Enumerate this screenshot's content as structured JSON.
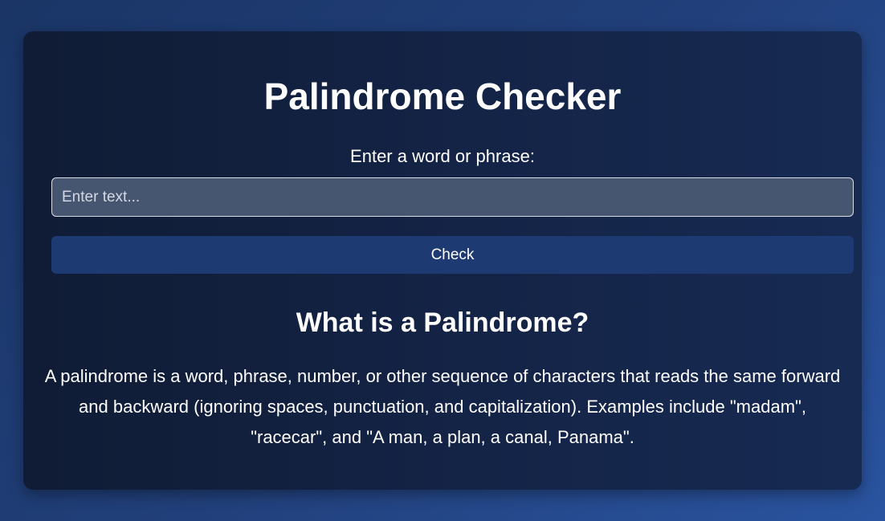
{
  "card": {
    "title": "Palindrome Checker",
    "input_label": "Enter a word or phrase:",
    "input_placeholder": "Enter text...",
    "input_value": "",
    "check_button_label": "Check",
    "section_heading": "What is a Palindrome?",
    "description": "A palindrome is a word, phrase, number, or other sequence of characters that reads the same forward and backward (ignoring spaces, punctuation, and capitalization). Examples include \"madam\", \"racecar\", and \"A man, a plan, a canal, Panama\"."
  },
  "colors": {
    "background_start": "#1a3566",
    "background_end": "#2a54a0",
    "card_background": "#142447",
    "input_background": "#465570",
    "button_background": "#1e3a72",
    "text": "#ffffff"
  }
}
